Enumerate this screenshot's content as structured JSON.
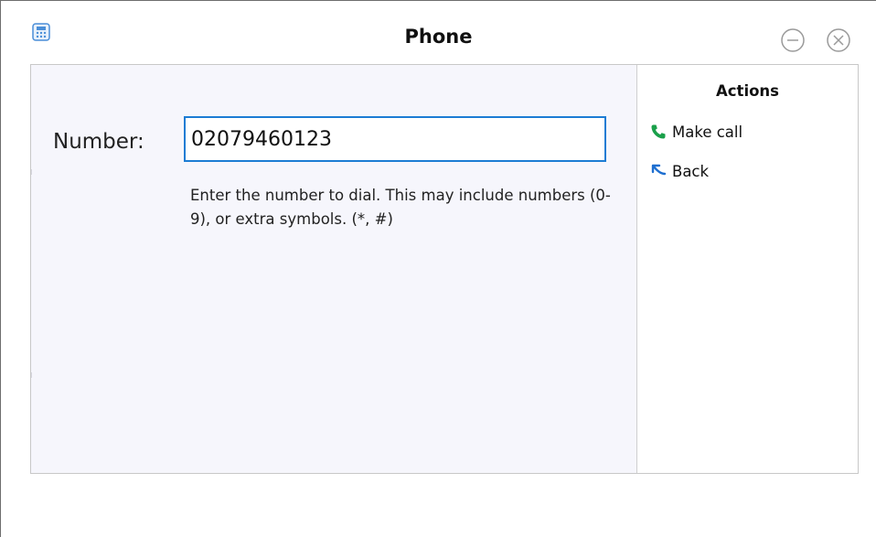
{
  "window": {
    "title": "Phone",
    "icon": "phone-app-icon"
  },
  "form": {
    "number_label": "Number:",
    "number_value": "02079460123",
    "help_text": "Enter the number to dial. This may include numbers (0-9), or extra symbols. (*, #)"
  },
  "actions": {
    "title": "Actions",
    "items": [
      {
        "label": "Make call",
        "icon": "phone-call-icon",
        "color": "#1aa04a"
      },
      {
        "label": "Back",
        "icon": "back-arrow-icon",
        "color": "#1e6fd0"
      }
    ]
  },
  "colors": {
    "accent": "#1c7cd4",
    "content_bg": "#f6f6fc"
  }
}
